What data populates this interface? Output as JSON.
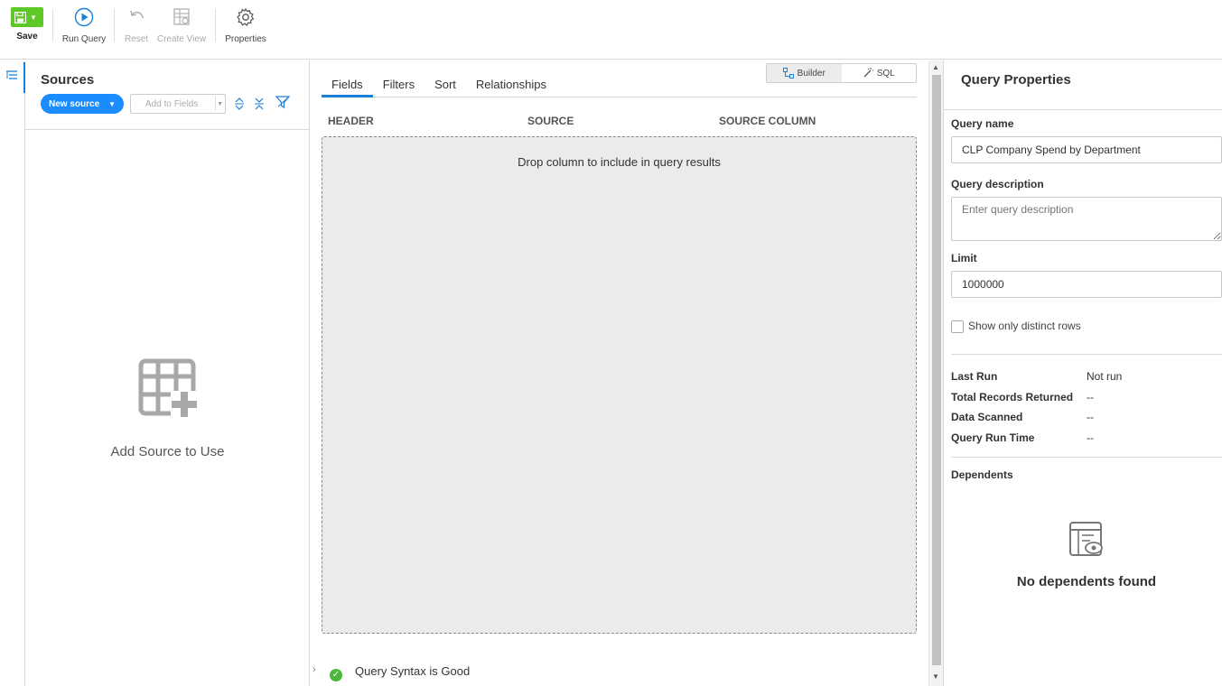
{
  "toolbar": {
    "save_label": "Save",
    "run_query_label": "Run Query",
    "reset_label": "Reset",
    "create_view_label": "Create View",
    "properties_label": "Properties",
    "save_color": "#5ec826"
  },
  "sources": {
    "title": "Sources",
    "new_source_label": "New source",
    "add_to_fields_label": "Add to Fields",
    "empty_message": "Add Source to Use",
    "icons": [
      "expand-all-icon",
      "collapse-all-icon",
      "filter-icon",
      "table-add-icon"
    ]
  },
  "center": {
    "mode": {
      "builder_label": "Builder",
      "sql_label": "SQL",
      "active": "Builder"
    },
    "tabs": [
      {
        "label": "Fields",
        "active": true
      },
      {
        "label": "Filters",
        "active": false
      },
      {
        "label": "Sort",
        "active": false
      },
      {
        "label": "Relationships",
        "active": false
      }
    ],
    "columns": {
      "header": "HEADER",
      "source": "SOURCE",
      "source_column": "SOURCE COLUMN"
    },
    "dropzone_message": "Drop column to include in query results",
    "status": "Query Syntax is Good",
    "accent_color": "#1a7fd6"
  },
  "properties": {
    "title": "Query Properties",
    "query_name_label": "Query name",
    "query_name_value": "CLP Company Spend by Department",
    "query_description_label": "Query description",
    "query_description_placeholder": "Enter query description",
    "limit_label": "Limit",
    "limit_value": "1000000",
    "distinct_label": "Show only distinct rows",
    "distinct_checked": false,
    "stats": {
      "last_run_label": "Last Run",
      "last_run_value": "Not run",
      "total_records_label": "Total Records Returned",
      "total_records_value": "--",
      "data_scanned_label": "Data Scanned",
      "data_scanned_value": "--",
      "run_time_label": "Query Run Time",
      "run_time_value": "--"
    },
    "dependents_label": "Dependents",
    "no_dependents": "No dependents found"
  }
}
